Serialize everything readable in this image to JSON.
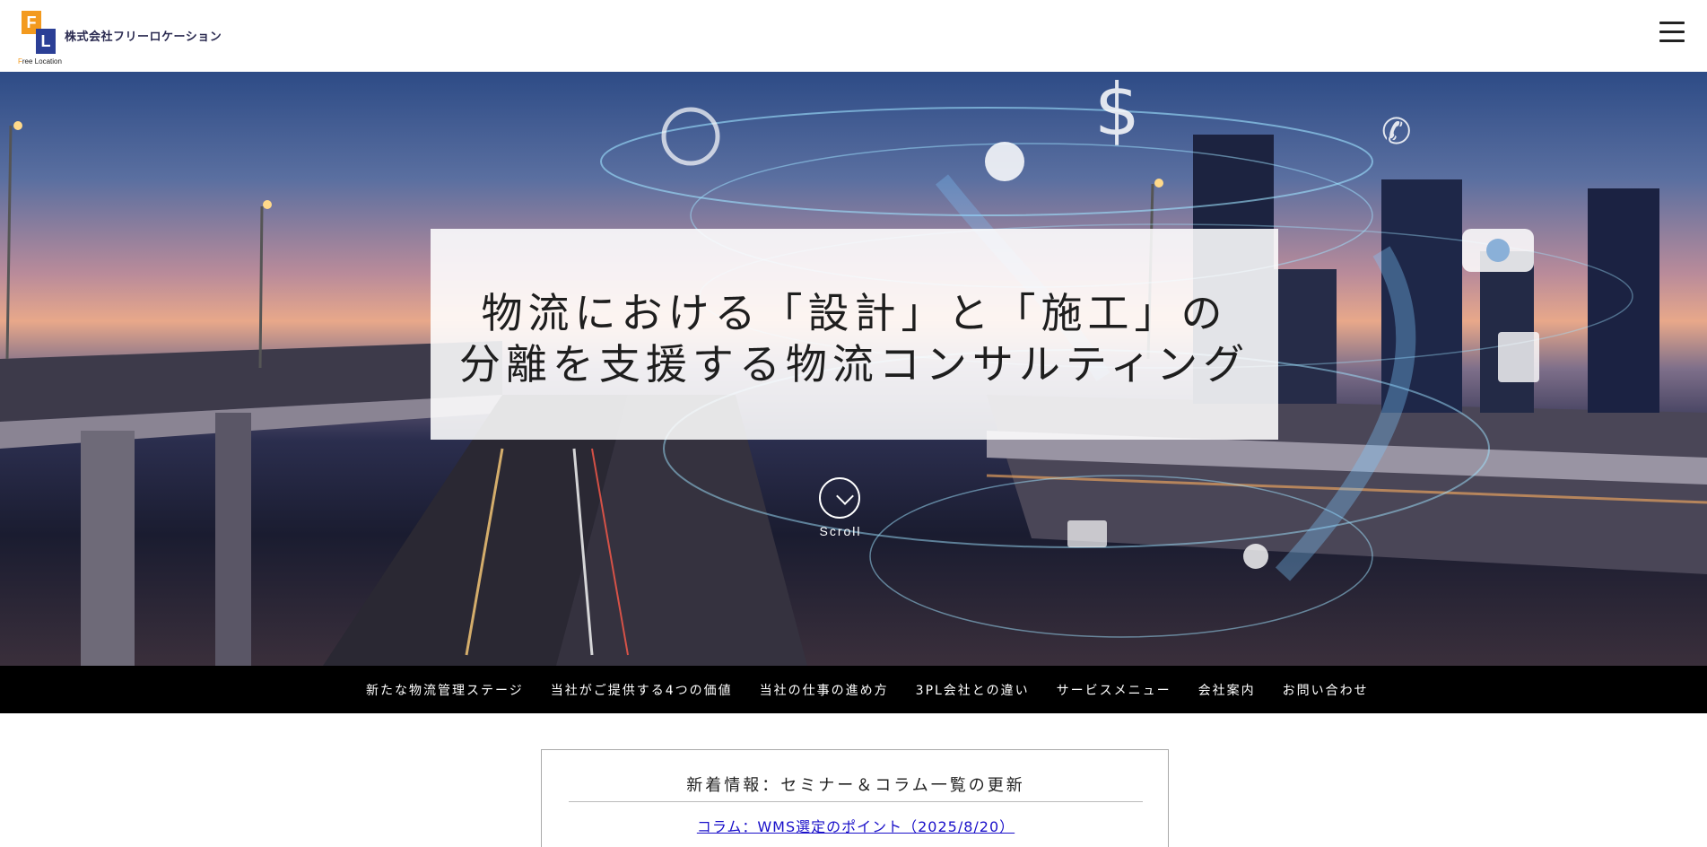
{
  "header": {
    "logo_letter_f": "F",
    "logo_letter_l": "L",
    "company_name": "株式会社フリーロケーション",
    "logo_sub_f": "F",
    "logo_sub_rest": "ree Location",
    "menu_icon": "hamburger-icon"
  },
  "hero": {
    "headline_line1": "物流における「設計」と「施工」の",
    "headline_line2": "分離を支援する物流コンサルティング",
    "scroll_label": "Scroll",
    "scroll_icon": "chevron-down-icon"
  },
  "nav": {
    "items": [
      "新たな物流管理ステージ",
      "当社がご提供する4つの価値",
      "当社の仕事の進め方",
      "3PL会社との違い",
      "サービスメニュー",
      "会社案内",
      "お問い合わせ"
    ]
  },
  "news": {
    "title": "新着情報：セミナー＆コラム一覧の更新",
    "link": "コラム：WMS選定のポイント（2025/8/20）"
  },
  "colors": {
    "logo_orange": "#f39a1e",
    "logo_blue": "#2b3f96",
    "nav_bg": "#000000",
    "link": "#1a10c9"
  }
}
